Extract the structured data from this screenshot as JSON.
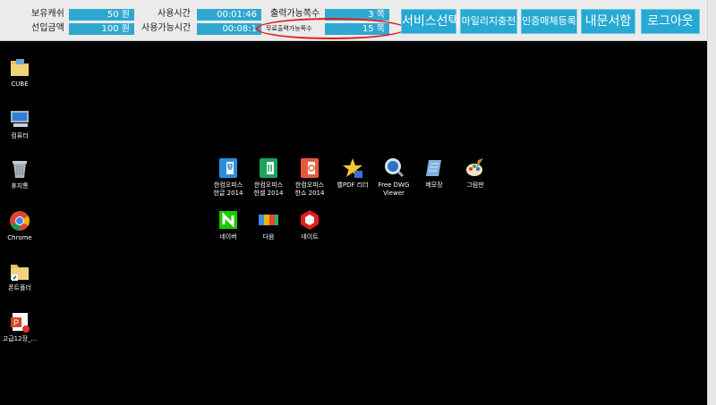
{
  "topbar": {
    "balance_label": "보유캐쉬",
    "balance_value": "50 원",
    "prepaid_label": "선입금액",
    "prepaid_value": "100 원",
    "usage_time_label": "사용시간",
    "usage_time_value": "00:01:46",
    "available_time_label": "사용가능시간",
    "available_time_value": "00:08:1",
    "printable_pages_label": "출력가능쪽수",
    "printable_pages_value": "3 쪽",
    "free_print_label": "무료출력가능쪽수",
    "free_print_value": "15 쪽",
    "buttons": {
      "service_select": "서비스선택",
      "mileage_charge": "마일리지충전",
      "auth_media": "인증매체등록",
      "my_documents": "내문서함",
      "logout": "로그아웃"
    },
    "colors": {
      "accent": "#26a9d2",
      "highlight": "#e01f1f"
    }
  },
  "desktop": {
    "left_icons": [
      {
        "label": "CUBE",
        "icon": "folder-icon"
      },
      {
        "label": "컴퓨터",
        "icon": "computer-icon"
      },
      {
        "label": "휴지통",
        "icon": "recycle-bin-icon"
      },
      {
        "label": "Chrome",
        "icon": "chrome-icon"
      },
      {
        "label": "폰트폴더",
        "icon": "folder-icon"
      },
      {
        "label": "고급12장_...",
        "icon": "powerpoint-icon"
      }
    ],
    "center_row1": [
      {
        "label1": "한컴오피스",
        "label2": "한글 2014",
        "icon": "hangul-icon"
      },
      {
        "label1": "한컴오피스",
        "label2": "한셀 2014",
        "icon": "hancell-icon"
      },
      {
        "label1": "한컴오피스",
        "label2": "한쇼 2014",
        "icon": "hanshow-icon"
      },
      {
        "label1": "벨PDF 리더",
        "label2": "",
        "icon": "pdf-reader-icon"
      },
      {
        "label1": "Free DWG",
        "label2": "Viewer",
        "icon": "dwg-viewer-icon"
      },
      {
        "label1": "메모장",
        "label2": "",
        "icon": "notepad-icon"
      },
      {
        "label1": "그림판",
        "label2": "",
        "icon": "paint-icon"
      }
    ],
    "center_row2": [
      {
        "label": "네이버",
        "icon": "naver-icon"
      },
      {
        "label": "다음",
        "icon": "daum-icon"
      },
      {
        "label": "네이트",
        "icon": "nate-icon"
      }
    ]
  }
}
